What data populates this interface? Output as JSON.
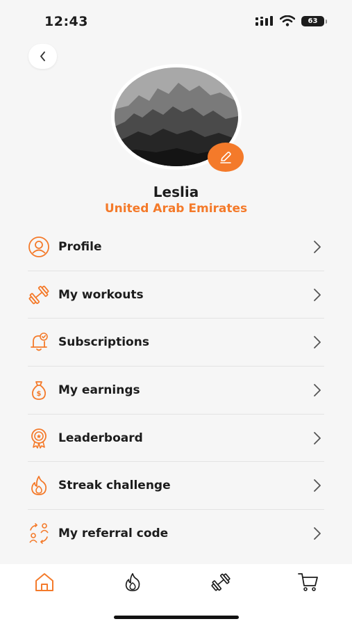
{
  "status_bar": {
    "time": "12:43",
    "battery": "63"
  },
  "profile": {
    "name": "Leslia",
    "country": "United Arab Emirates"
  },
  "menu": {
    "items": [
      {
        "label": "Profile",
        "icon": "user-circle-icon"
      },
      {
        "label": "My workouts",
        "icon": "dumbbell-icon"
      },
      {
        "label": "Subscriptions",
        "icon": "bell-check-icon"
      },
      {
        "label": "My earnings",
        "icon": "money-bag-icon"
      },
      {
        "label": "Leaderboard",
        "icon": "award-badge-icon"
      },
      {
        "label": "Streak challenge",
        "icon": "flame-icon"
      },
      {
        "label": "My referral code",
        "icon": "referral-users-icon"
      }
    ]
  },
  "tab_bar": {
    "tabs": [
      {
        "icon": "home-icon",
        "active": true
      },
      {
        "icon": "flame-icon",
        "active": false
      },
      {
        "icon": "dumbbell-icon",
        "active": false
      },
      {
        "icon": "cart-icon",
        "active": false
      }
    ]
  },
  "colors": {
    "accent": "#f47a2a",
    "background": "#f6f6f6",
    "text": "#1c1c1c"
  }
}
